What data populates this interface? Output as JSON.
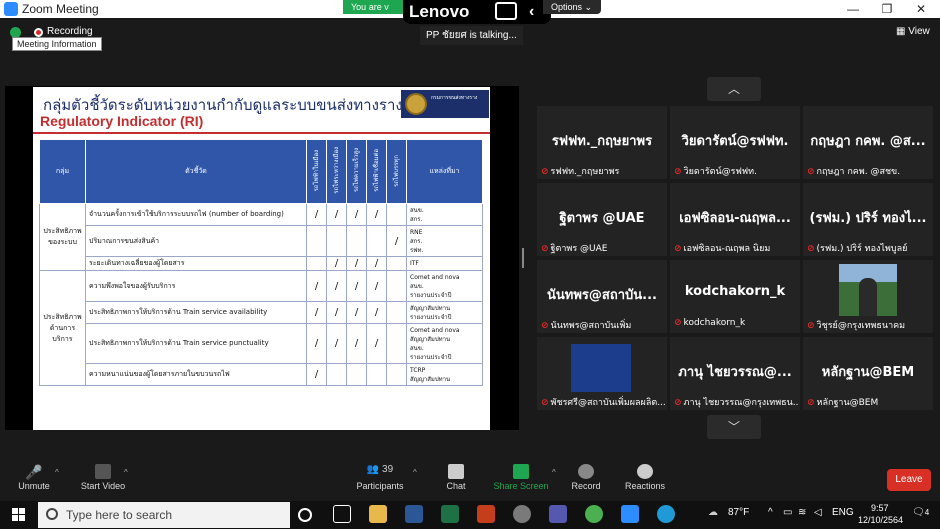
{
  "window": {
    "title": "Zoom Meeting",
    "min": "—",
    "restore": "❐",
    "close": "✕"
  },
  "meeting": {
    "recording": "Recording",
    "tooltip": "Meeting Information",
    "green_banner": "You are v",
    "brand": "Lenovo",
    "options": "Options ⌄",
    "talking": "PP ชัยยศ is talking...",
    "view": "View"
  },
  "slide": {
    "title_th": "กลุ่มตัวชี้วัดระดับหน่วยงานกำกับดูแลระบบขนส่งทางราง",
    "title_en": "Regulatory Indicator (RI)",
    "logo_text": "กรมการขนส่งทางราง",
    "headers": {
      "group": "กลุ่ม",
      "indicator": "ตัวชี้วัด",
      "c1": "รถไฟฟ้าในเมือง",
      "c2": "รถไฟระหว่างเมือง",
      "c3": "รถไฟความเร็วสูง",
      "c4": "รถไฟฟ้าเชื่อมต่อ",
      "c5": "รถไฟบรรทุก",
      "source": "แหล่งที่มา"
    },
    "rows": [
      {
        "group": "ประสิทธิภาพ ของระบบ",
        "span": 3,
        "indicator": "จำนวนครั้งการเข้าใช้บริการระบบรถไฟ (number of boarding)",
        "marks": [
          "/",
          "/",
          "/",
          "/",
          ""
        ],
        "source": [
          "สนข.",
          "สกร."
        ]
      },
      {
        "indicator": "ปริมาณการขนส่งสินค้า",
        "marks": [
          "",
          "",
          "",
          "",
          "/"
        ],
        "source": [
          "RNE",
          "สกร.",
          "รฟท."
        ]
      },
      {
        "indicator": "ระยะเดินทางเฉลี่ยของผู้โดยสาร",
        "marks": [
          "",
          "/",
          "/",
          "/",
          ""
        ],
        "source": [
          "ITF"
        ]
      },
      {
        "group": "ประสิทธิภาพ ด้านการ บริการ",
        "span": 4,
        "indicator": "ความพึงพอใจของผู้รับบริการ",
        "marks": [
          "/",
          "/",
          "/",
          "/",
          ""
        ],
        "source": [
          "Comet and nova",
          "สนข.",
          "รายงานประจำปี"
        ]
      },
      {
        "indicator": "ประสิทธิภาพการให้บริการด้าน Train service availability",
        "marks": [
          "/",
          "/",
          "/",
          "/",
          ""
        ],
        "source": [
          "สัญญาสัมปทาน",
          "รายงานประจำปี"
        ]
      },
      {
        "indicator": "ประสิทธิภาพการให้บริการด้าน Train service punctuality",
        "marks": [
          "/",
          "/",
          "/",
          "/",
          ""
        ],
        "source": [
          "Comet and nova",
          "สัญญาสัมปทาน",
          "สนข.",
          "รายงานประจำปี"
        ]
      },
      {
        "indicator": "ความหนาแน่นของผู้โดยสารภายในขบวนรถไฟ",
        "marks": [
          "/",
          "",
          "",
          "",
          ""
        ],
        "source": [
          "TCRP",
          "สัญญาสัมปทาน"
        ]
      }
    ]
  },
  "gallery": {
    "up": "︿",
    "down": "﹀",
    "tiles": [
      {
        "name": "รฟฟท._กฤษยาพร",
        "label": "รฟฟท._กฤษยาพร",
        "video": false
      },
      {
        "name": "วิยดารัตน์@รฟฟท.",
        "label": "วิยดารัตน์@รฟฟท.",
        "video": false
      },
      {
        "name": "กฤษฎา กคพ. @ส...",
        "label": "กฤษฎา กคพ. @สชข.",
        "video": false
      },
      {
        "name": "ฐิตาพร @UAE",
        "label": "ฐิตาพร @UAE",
        "video": false
      },
      {
        "name": "เอฟซิลอน-ณฤพล...",
        "label": "เอฟซิลอน-ณฤพล นิยม",
        "video": false
      },
      {
        "name": "(รฟม.) ปริร์ ทองไ...",
        "label": "(รฟม.) ปริร์ ทองไพบูลย์",
        "video": false
      },
      {
        "name": "นันทพร@สถาบัน...",
        "label": "นันทพร@สถาบันเพิ่ม",
        "video": false
      },
      {
        "name": "kodchakorn_k",
        "label": "kodchakorn_k",
        "video": false
      },
      {
        "name": "",
        "label": "วิชุรย์@กรุงเทพธนาคม",
        "video": "person"
      },
      {
        "name": "",
        "label": "พัชรศรี@สถาบันเพิ่มผลผลิต...",
        "video": "slide"
      },
      {
        "name": "ภานุ ไชยวรรณ@...",
        "label": "ภานุ ไชยวรรณ@กรุงเทพธน...",
        "video": false
      },
      {
        "name": "หลักฐาน@BEM",
        "label": "หลักฐาน@BEM",
        "video": false
      }
    ]
  },
  "toolbar": {
    "unmute": "Unmute",
    "start_video": "Start Video",
    "participants": "Participants",
    "participants_count": "39",
    "chat": "Chat",
    "share": "Share Screen",
    "record": "Record",
    "reactions": "Reactions",
    "leave": "Leave"
  },
  "taskbar": {
    "search_placeholder": "Type here to search",
    "weather": "87°F",
    "lang": "ENG",
    "time": "9:57",
    "date": "12/10/2564",
    "notif": "4"
  },
  "colors": {
    "accent": "#2d8cff",
    "green": "#1ea750",
    "leave": "#d93025",
    "slide_blue": "#2f56a8"
  }
}
